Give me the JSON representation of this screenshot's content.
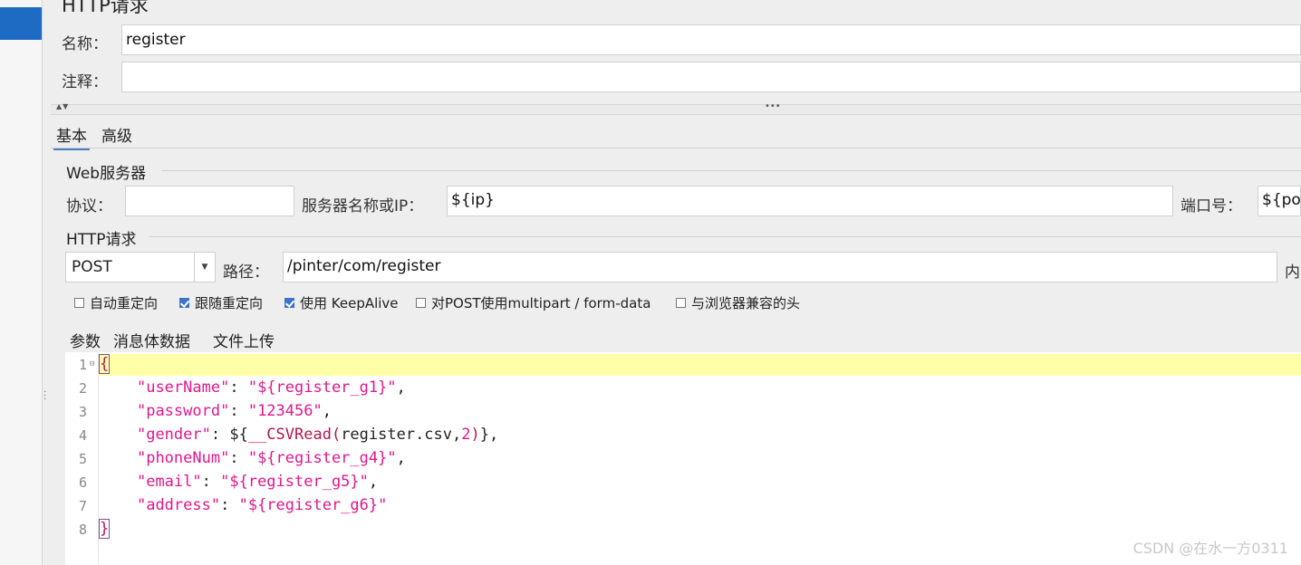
{
  "panel": {
    "title": "HTTP请求"
  },
  "name_field": {
    "label": "名称：",
    "value": "register"
  },
  "comment_field": {
    "label": "注释：",
    "value": ""
  },
  "tabs": [
    {
      "label": "基本",
      "active": true
    },
    {
      "label": "高级",
      "active": false
    }
  ],
  "web_server": {
    "title": "Web服务器",
    "protocol_label": "协议：",
    "protocol_value": "",
    "server_label": "服务器名称或IP：",
    "server_value": "${ip}",
    "port_label": "端口号：",
    "port_value": "${por"
  },
  "http_request": {
    "title": "HTTP请求",
    "method": "POST",
    "path_label": "路径：",
    "path_value": "/pinter/com/register",
    "encoding_label": "内"
  },
  "options": [
    {
      "label": "自动重定向",
      "checked": false
    },
    {
      "label": "跟随重定向",
      "checked": true
    },
    {
      "label": "使用 KeepAlive",
      "checked": true
    },
    {
      "label": "对POST使用multipart / form-data",
      "checked": false
    },
    {
      "label": "与浏览器兼容的头",
      "checked": false
    }
  ],
  "body_tabs": [
    {
      "label": "参数",
      "active": false
    },
    {
      "label": "消息体数据",
      "active": true
    },
    {
      "label": "文件上传",
      "active": false
    }
  ],
  "editor": {
    "line_numbers": [
      "1",
      "2",
      "3",
      "4",
      "5",
      "6",
      "7",
      "8"
    ],
    "lines": [
      {
        "key": "userName",
        "value": "\"${register_g1}\"",
        "trail": ","
      },
      {
        "key": "password",
        "value": "\"123456\"",
        "trail": ","
      },
      {
        "key": "gender",
        "csv_file": "register.csv",
        "csv_arg": "2",
        "trail": ","
      },
      {
        "key": "phoneNum",
        "value": "\"${register_g4}\"",
        "trail": ","
      },
      {
        "key": "email",
        "value": "\"${register_g5}\"",
        "trail": ","
      },
      {
        "key": "address",
        "value": "\"${register_g6}\"",
        "trail": ""
      }
    ]
  },
  "watermark": "CSDN @在水一方0311",
  "colors": {
    "selected_node": "#1e6bc4",
    "active_line": "#ffffa8",
    "string": "#e0188e",
    "checkbox": "#3d74c7"
  }
}
